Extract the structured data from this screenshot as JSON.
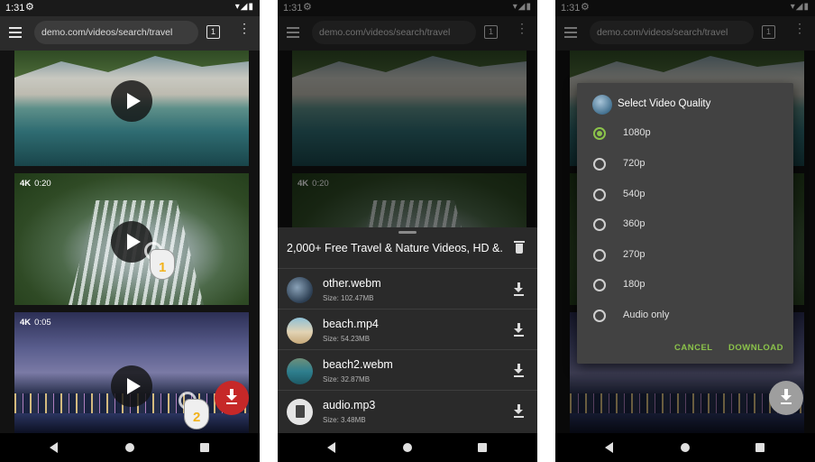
{
  "status_bar": {
    "time": "1:31"
  },
  "browser": {
    "url": "demo.com/videos/search/travel",
    "tab_count": "1"
  },
  "videos": [
    {
      "quality": "",
      "duration": ""
    },
    {
      "quality": "4K",
      "duration": "0:20"
    },
    {
      "quality": "4K",
      "duration": "0:05"
    }
  ],
  "gesture_steps": [
    "1",
    "2"
  ],
  "download_sheet": {
    "title": "2,000+ Free Travel & Nature Videos, HD &...",
    "files": [
      {
        "name": "other.webm",
        "size": "Size: 102.47MB"
      },
      {
        "name": "beach.mp4",
        "size": "Size: 54.23MB"
      },
      {
        "name": "beach2.webm",
        "size": "Size: 32.87MB"
      },
      {
        "name": "audio.mp3",
        "size": "Size: 3.48MB"
      }
    ]
  },
  "quality_dialog": {
    "title": "Select Video Quality",
    "options": [
      "1080p",
      "720p",
      "540p",
      "360p",
      "270p",
      "180p",
      "Audio only"
    ],
    "selected": "1080p",
    "cancel_label": "CANCEL",
    "download_label": "DOWNLOAD"
  },
  "colors": {
    "accent": "#8bc34a",
    "fab_red": "#c62828",
    "step_number": "#f2b21b"
  },
  "icons": [
    "hamburger-menu-icon",
    "gear-icon",
    "wifi-icon",
    "signal-icon",
    "battery-icon",
    "play-icon",
    "download-icon",
    "trash-icon",
    "file-icon",
    "back-icon",
    "home-icon",
    "recents-icon"
  ]
}
